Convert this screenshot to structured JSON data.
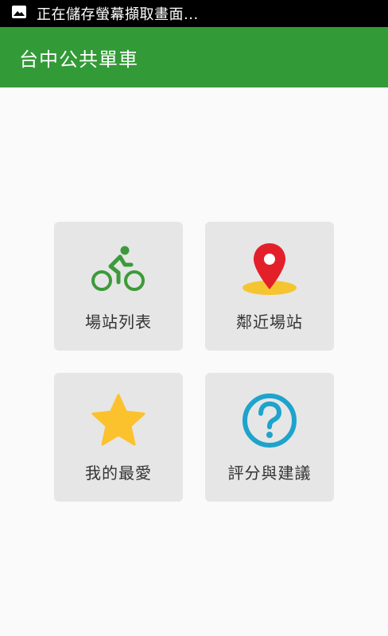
{
  "status_bar": {
    "notification_text": "正在儲存螢幕擷取畫面...",
    "icon": "image-icon"
  },
  "app_bar": {
    "title": "台中公共單車"
  },
  "menu": {
    "items": [
      {
        "label": "場站列表",
        "icon": "cyclist-icon",
        "icon_color": "#3d9a3a"
      },
      {
        "label": "鄰近場站",
        "icon": "map-pin-icon",
        "icon_color": "#e3202a"
      },
      {
        "label": "我的最愛",
        "icon": "star-icon",
        "icon_color": "#fcc22d"
      },
      {
        "label": "評分與建議",
        "icon": "question-icon",
        "icon_color": "#1ea3cc"
      }
    ]
  },
  "colors": {
    "app_bar": "#329a36",
    "status_bar": "#000000",
    "tile_background": "#e6e6e6",
    "page_background": "#fafafa"
  }
}
